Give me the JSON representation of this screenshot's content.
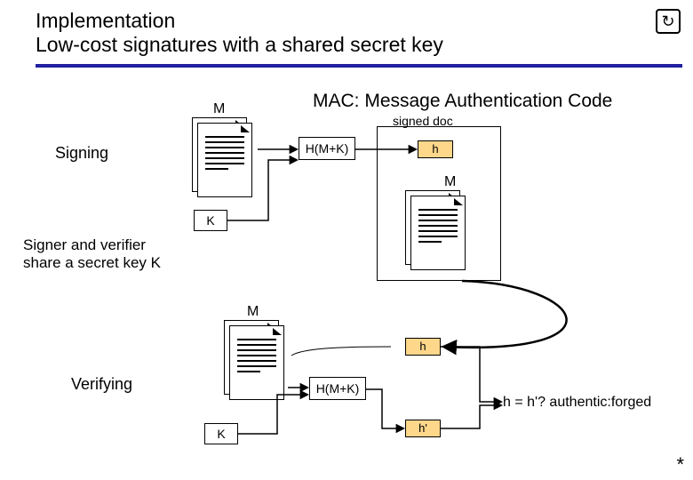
{
  "title": {
    "line1": "Implementation",
    "line2": "Low-cost signatures with a shared secret key"
  },
  "mac_title": "MAC: Message Authentication Code",
  "labels": {
    "signed_doc": "signed doc",
    "signing": "Signing",
    "verifying": "Verifying",
    "M": "M",
    "K": "K",
    "h": "h",
    "h_prime": "h'",
    "hash": "H(M+K)",
    "note_share": "Signer and verifier\nshare a secret key K",
    "equation": "h = h'? authentic:forged"
  },
  "icons": {
    "return": "↻",
    "asterisk": "*"
  },
  "colors": {
    "rule": "#2020a0",
    "tag": "#ffd78a"
  }
}
